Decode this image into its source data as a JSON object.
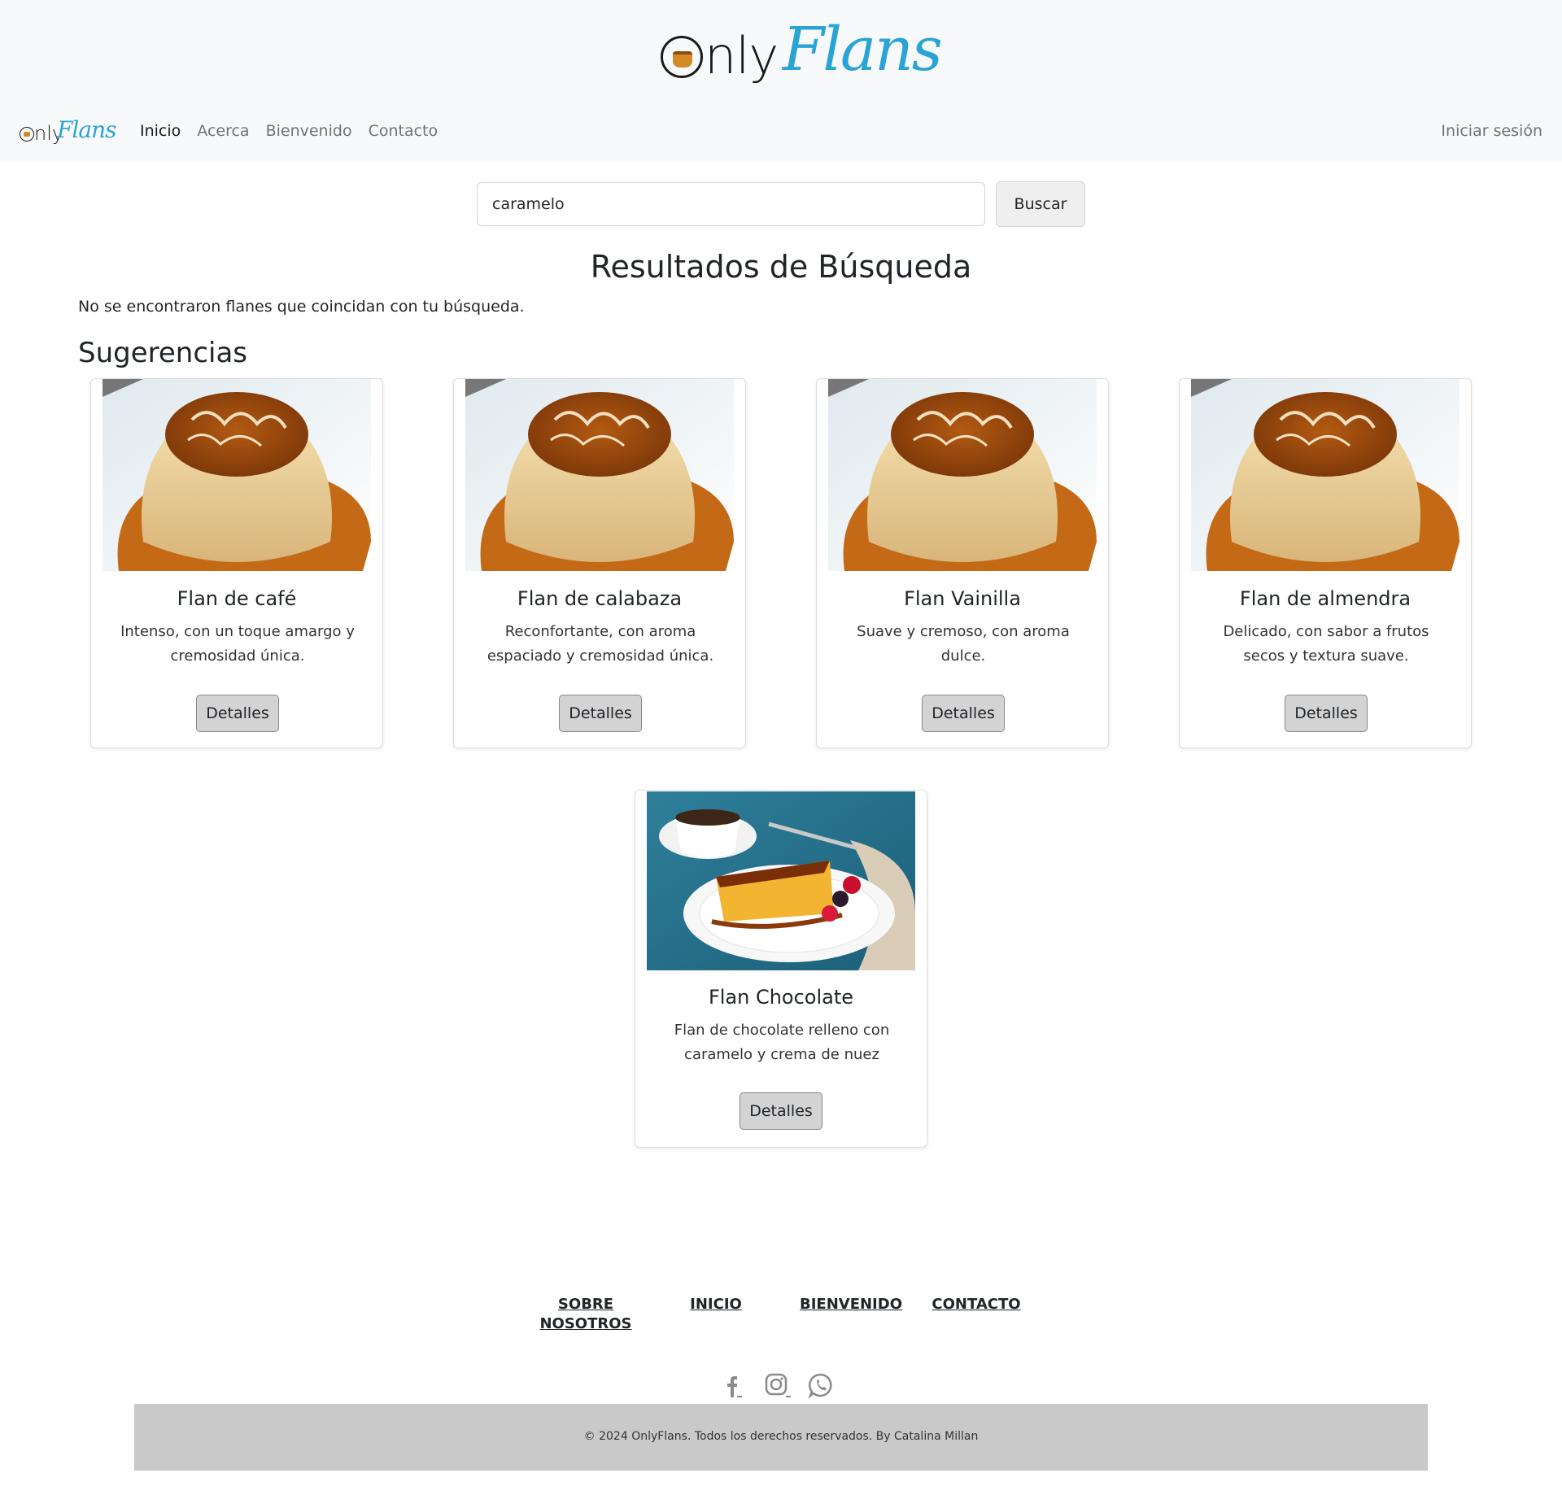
{
  "brand": {
    "only": "nly",
    "flans": "Flans"
  },
  "nav": {
    "items": [
      {
        "label": "Inicio",
        "active": true
      },
      {
        "label": "Acerca",
        "active": false
      },
      {
        "label": "Bienvenido",
        "active": false
      },
      {
        "label": "Contacto",
        "active": false
      }
    ],
    "login": "Iniciar sesión"
  },
  "search": {
    "value": "caramelo",
    "button": "Buscar"
  },
  "results": {
    "title": "Resultados de Búsqueda",
    "empty_message": "No se encontraron flanes que coincidan con tu búsqueda."
  },
  "suggestions": {
    "title": "Sugerencias",
    "cards": [
      {
        "title": "Flan de café",
        "description": "Intenso, con un toque amargo y cremosidad única.",
        "button": "Detalles"
      },
      {
        "title": "Flan de calabaza",
        "description": "Reconfortante, con aroma espaciado y cremosidad única.",
        "button": "Detalles"
      },
      {
        "title": "Flan Vainilla",
        "description": "Suave y cremoso, con aroma dulce.",
        "button": "Detalles"
      },
      {
        "title": "Flan de almendra",
        "description": "Delicado, con sabor a frutos secos y textura suave.",
        "button": "Detalles"
      },
      {
        "title": "Flan Chocolate",
        "description": "Flan de chocolate relleno con caramelo y crema de nuez",
        "button": "Detalles"
      }
    ]
  },
  "footer": {
    "links": [
      "SOBRE NOSOTROS",
      "INICIO",
      "BIENVENIDO",
      "CONTACTO"
    ],
    "social": [
      "facebook-icon",
      "instagram-icon",
      "whatsapp-icon"
    ],
    "copyright": "© 2024 OnlyFlans. Todos los derechos reservados. By Catalina Millan"
  },
  "colors": {
    "brand_blue": "#2aa4d4",
    "caramel": "#c46a17",
    "footer_band": "#c9c9c9"
  }
}
